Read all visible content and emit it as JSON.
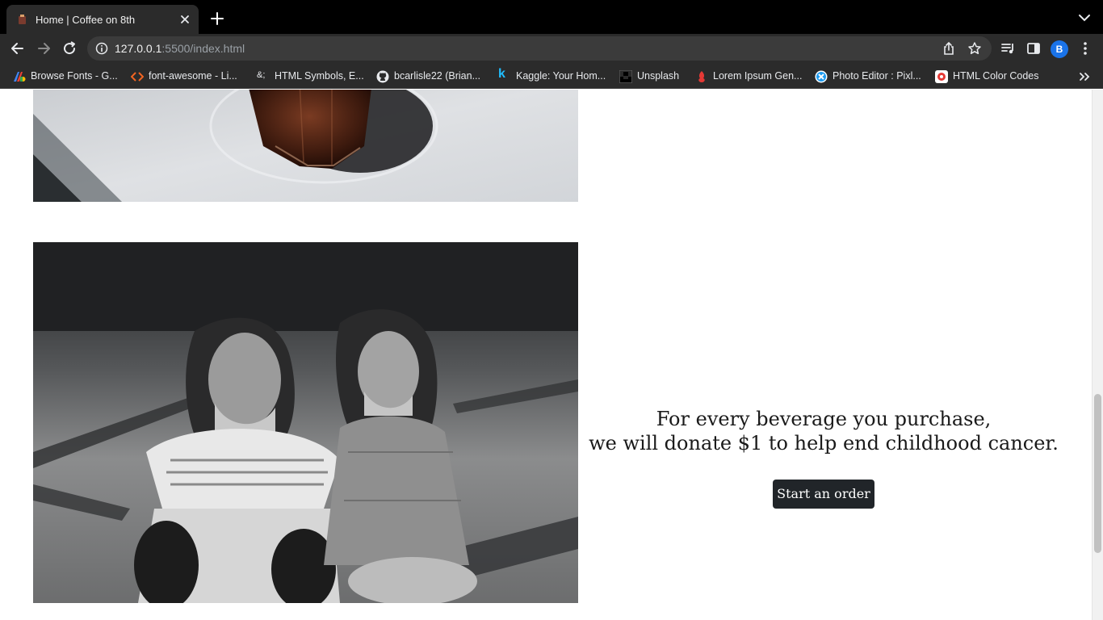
{
  "browser": {
    "tab": {
      "title": "Home | Coffee on 8th"
    },
    "url": {
      "host": "127.0.0.1",
      "path": ":5500/index.html"
    },
    "profile_initial": "B",
    "bookmarks": [
      {
        "label": "Browse Fonts - G...",
        "icon": "google-fonts-icon"
      },
      {
        "label": "font-awesome - Li...",
        "icon": "code-icon"
      },
      {
        "label": "HTML Symbols, E...",
        "icon": "ampersand-icon",
        "icon_text": "&;"
      },
      {
        "label": "bcarlisle22 (Brian...",
        "icon": "github-icon"
      },
      {
        "label": "Kaggle: Your Hom...",
        "icon": "kaggle-icon",
        "icon_text": "k"
      },
      {
        "label": "Unsplash",
        "icon": "unsplash-icon"
      },
      {
        "label": "Lorem Ipsum Gen...",
        "icon": "lorem-ipsum-icon"
      },
      {
        "label": "Photo Editor : Pixl...",
        "icon": "pixlr-icon"
      },
      {
        "label": "HTML Color Codes",
        "icon": "color-codes-icon"
      }
    ]
  },
  "page": {
    "images": {
      "coffee": "coffee-glass-photo",
      "kids": "laughing-girls-photo"
    },
    "cta": {
      "line1": "For every beverage you purchase,",
      "line2": "we will donate $1 to help end childhood cancer.",
      "button": "Start an order"
    }
  },
  "colors": {
    "button_bg": "#212529",
    "button_text": "#ffffff",
    "text": "#1a1a1a",
    "chrome_dark": "#2b2b2b",
    "profile_blue": "#1a73e8"
  }
}
